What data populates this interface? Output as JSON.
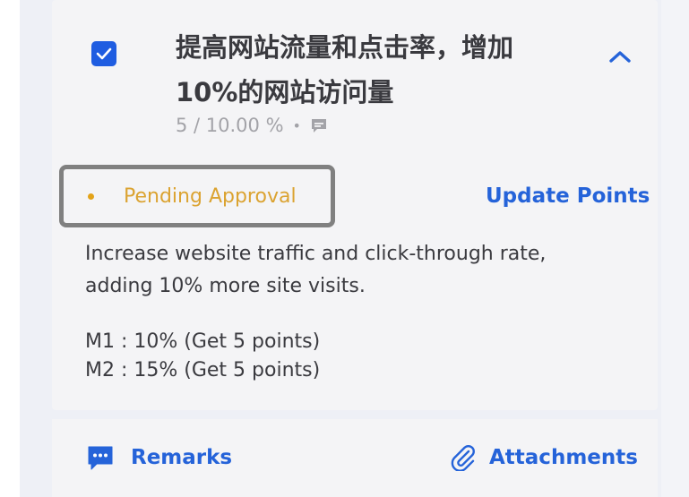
{
  "task": {
    "title_line1": "提高网站流量和点击率，增加",
    "title_line2": "10%的网站访问量",
    "meta_points": "5 / 10.00 %",
    "meta_separator": "•",
    "checked": true
  },
  "status": {
    "label": "Pending Approval",
    "color": "#dba331"
  },
  "actions": {
    "update_points": "Update Points"
  },
  "description": {
    "line1": "Increase website traffic and click-through rate,",
    "line2": "adding 10% more site visits."
  },
  "milestones": [
    {
      "label": "M1 : 10% (Get 5 points)"
    },
    {
      "label": "M2 : 15% (Get 5 points)"
    }
  ],
  "footer": {
    "remarks_label": "Remarks",
    "attachments_label": "Attachments"
  },
  "icons": {
    "checkbox": "check-icon",
    "collapse": "chevron-up-icon",
    "comment": "comment-icon",
    "remarks": "chat-bubble-icon",
    "attachments": "paperclip-icon"
  },
  "colors": {
    "accent": "#2563d9",
    "checkbox": "#1f5de1",
    "pending": "#dba331",
    "text": "#3a3a3f",
    "muted": "#a3a3a8"
  }
}
